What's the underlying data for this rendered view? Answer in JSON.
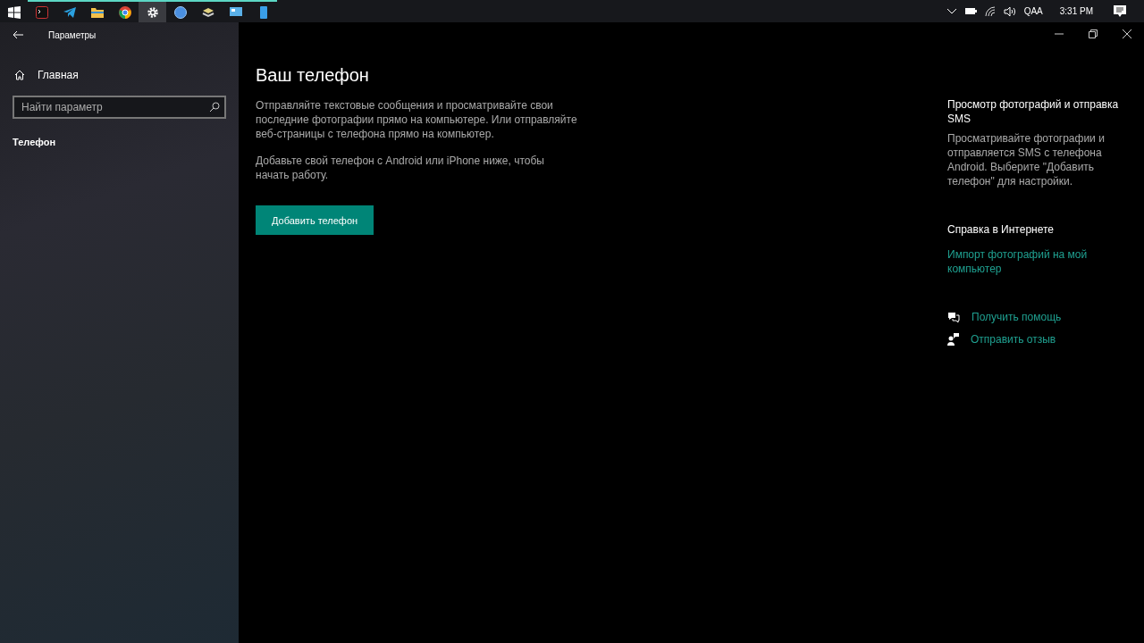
{
  "taskbar": {
    "apps": [
      {
        "kind": "start",
        "running": false,
        "selected": false
      },
      {
        "kind": "terminal",
        "running": true,
        "selected": false
      },
      {
        "kind": "telegram",
        "running": true,
        "selected": false
      },
      {
        "kind": "folder",
        "running": true,
        "selected": false
      },
      {
        "kind": "chrome",
        "running": true,
        "selected": false
      },
      {
        "kind": "gear",
        "running": true,
        "selected": true
      },
      {
        "kind": "torrent",
        "running": true,
        "selected": false
      },
      {
        "kind": "tray",
        "running": true,
        "selected": false
      },
      {
        "kind": "monitor",
        "running": true,
        "selected": false
      },
      {
        "kind": "phone",
        "running": true,
        "selected": false
      }
    ],
    "language": "QAA",
    "time": "3:31 PM"
  },
  "window": {
    "title": "Параметры"
  },
  "sidebar": {
    "home": "Главная",
    "search": {
      "placeholder": "Найти параметр"
    },
    "section": "Телефон"
  },
  "main": {
    "title": "Ваш телефон",
    "paragraphs": [
      "Отправляйте текстовые сообщения и просматривайте свои последние фотографии прямо на компьютере. Или отправляйте веб-страницы с телефона прямо на компьютер.",
      "Добавьте свой телефон с Android или iPhone ниже, чтобы начать работу."
    ],
    "button": "Добавить телефон"
  },
  "aside": {
    "heading": "Просмотр фотографий и отправка SMS",
    "text": "Просматривайте фотографии и отправляется SMS с телефона Android. Выберите \"Добавить телефон\" для настройки.",
    "help_heading": "Справка в Интернете",
    "link": "Импорт фотографий на мой компьютер",
    "actions": [
      {
        "kind": "help",
        "label": "Получить помощь"
      },
      {
        "kind": "feedback",
        "label": "Отправить отзыв"
      }
    ]
  }
}
